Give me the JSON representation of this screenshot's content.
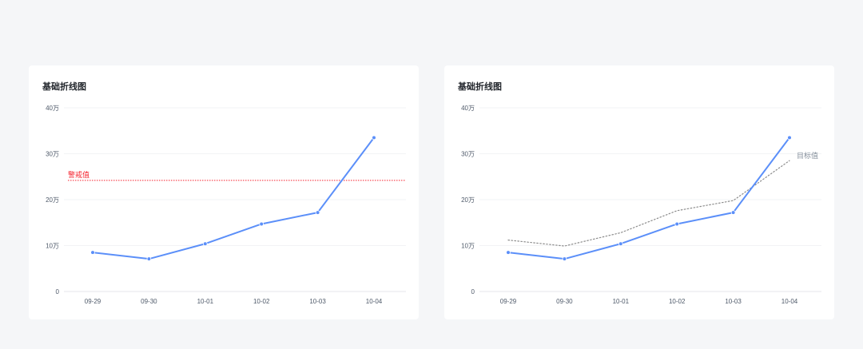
{
  "chart_data": [
    {
      "type": "line",
      "title": "基础折线图",
      "categories": [
        "09-29",
        "09-30",
        "10-01",
        "10-02",
        "10-03",
        "10-04"
      ],
      "y_ticks": [
        "0",
        "10万",
        "20万",
        "30万",
        "40万"
      ],
      "ylim": [
        0,
        400000
      ],
      "grid": true,
      "series": [
        {
          "values": [
            85000,
            71000,
            104000,
            147000,
            172000,
            335000
          ],
          "color": "#5b8ff9",
          "style": "solid",
          "markers": true
        }
      ],
      "reference_line": {
        "label": "警戒值",
        "value": 242000,
        "color": "#f5222d"
      }
    },
    {
      "type": "line",
      "title": "基础折线图",
      "categories": [
        "09-29",
        "09-30",
        "10-01",
        "10-02",
        "10-03",
        "10-04"
      ],
      "y_ticks": [
        "0",
        "10万",
        "20万",
        "30万",
        "40万"
      ],
      "ylim": [
        0,
        400000
      ],
      "grid": true,
      "series": [
        {
          "values": [
            85000,
            71000,
            104000,
            147000,
            172000,
            335000
          ],
          "color": "#5b8ff9",
          "style": "solid",
          "markers": true
        },
        {
          "name": "目标值",
          "values": [
            112000,
            99000,
            128000,
            176000,
            198000,
            285000
          ],
          "color": "#8c8c8c",
          "style": "dotted",
          "markers": false
        }
      ]
    }
  ]
}
